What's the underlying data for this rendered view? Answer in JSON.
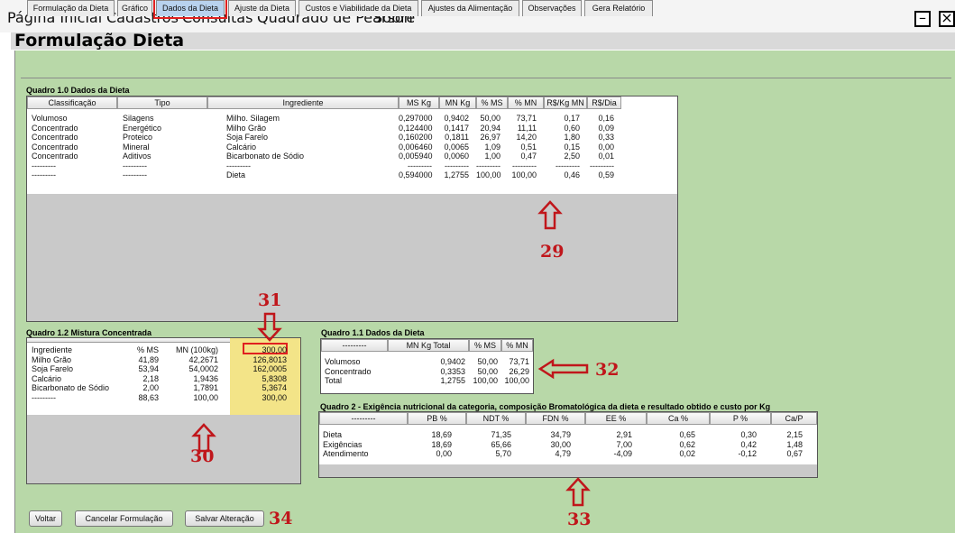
{
  "menu": [
    "Página Inicial",
    "Cadastros",
    "Consultas",
    "Quadrado de Pearson",
    "Sobre"
  ],
  "window": {
    "minimize": "–",
    "close": "×"
  },
  "title": "Formulação Dieta",
  "tabs": [
    "Formulação da Dieta",
    "Gráfico",
    "Dados da Dieta",
    "Ajuste da Dieta",
    "Custos e Viabilidade da Dieta",
    "Ajustes da Alimentação",
    "Observações",
    "Gera Relatório"
  ],
  "q10": {
    "title": "Quadro 1.0 Dados da Dieta",
    "headers": [
      "Classificação",
      "Tipo",
      "Ingrediente",
      "MS Kg",
      "MN Kg",
      "% MS",
      "% MN",
      "R$/Kg MN",
      "R$/Dia"
    ],
    "rows": [
      [
        "Volumoso",
        "Silagens",
        "Milho. Silagem",
        "0,297000",
        "0,9402",
        "50,00",
        "73,71",
        "0,17",
        "0,16"
      ],
      [
        "Concentrado",
        "Energético",
        "Milho Grão",
        "0,124400",
        "0,1417",
        "20,94",
        "11,11",
        "0,60",
        "0,09"
      ],
      [
        "Concentrado",
        "Proteico",
        "Soja Farelo",
        "0,160200",
        "0,1811",
        "26,97",
        "14,20",
        "1,80",
        "0,33"
      ],
      [
        "Concentrado",
        "Mineral",
        "Calcário",
        "0,006460",
        "0,0065",
        "1,09",
        "0,51",
        "0,15",
        "0,00"
      ],
      [
        "Concentrado",
        "Aditivos",
        "Bicarbonato de Sódio",
        "0,005940",
        "0,0060",
        "1,00",
        "0,47",
        "2,50",
        "0,01"
      ],
      [
        "---------",
        "---------",
        "---------",
        "---------",
        "---------",
        "---------",
        "---------",
        "---------",
        "---------"
      ],
      [
        "---------",
        "---------",
        "Dieta",
        "0,594000",
        "1,2755",
        "100,00",
        "100,00",
        "0,46",
        "0,59"
      ]
    ]
  },
  "q12": {
    "title": "Quadro 1.2 Mistura Concentrada",
    "rows": [
      [
        "Ingrediente",
        "% MS",
        "MN (100kg)",
        "300,00"
      ],
      [
        "Milho Grão",
        "41,89",
        "42,2671",
        "126,8013"
      ],
      [
        "Soja Farelo",
        "53,94",
        "54,0002",
        "162,0005"
      ],
      [
        "Calcário",
        "2,18",
        "1,9436",
        "5,8308"
      ],
      [
        "Bicarbonato de Sódio",
        "2,00",
        "1,7891",
        "5,3674"
      ],
      [
        "---------",
        "88,63",
        "100,00",
        "300,00"
      ]
    ]
  },
  "q11": {
    "title": "Quadro 1.1 Dados da Dieta",
    "headers": [
      "---------",
      "MN Kg Total",
      "% MS",
      "% MN"
    ],
    "rows": [
      [
        "Volumoso",
        "0,9402",
        "50,00",
        "73,71"
      ],
      [
        "Concentrado",
        "0,3353",
        "50,00",
        "26,29"
      ],
      [
        "Total",
        "1,2755",
        "100,00",
        "100,00"
      ]
    ]
  },
  "q2": {
    "title": "Quadro 2 - Exigência nutricional da categoria, composição Bromatológica da dieta e resultado obtido e custo por Kg",
    "headers": [
      "---------",
      "PB %",
      "NDT %",
      "FDN %",
      "EE %",
      "Ca %",
      "P %",
      "Ca/P"
    ],
    "rows": [
      [
        "Dieta",
        "18,69",
        "71,35",
        "34,79",
        "2,91",
        "0,65",
        "0,30",
        "2,15"
      ],
      [
        "Exigências",
        "18,69",
        "65,66",
        "30,00",
        "7,00",
        "0,62",
        "0,42",
        "1,48"
      ],
      [
        "Atendimento",
        "0,00",
        "5,70",
        "4,79",
        "-4,09",
        "0,02",
        "-0,12",
        "0,67"
      ]
    ]
  },
  "buttons": {
    "back": "Voltar",
    "cancel": "Cancelar Formulação",
    "save": "Salvar Alteração"
  },
  "annotations": {
    "a29": "29",
    "a30": "30",
    "a31": "31",
    "a32": "32",
    "a33": "33",
    "a34": "34"
  },
  "colors": {
    "panel_bg": "#b8d8a8",
    "annotation": "#c0161b",
    "highlight": "#f3e488"
  }
}
